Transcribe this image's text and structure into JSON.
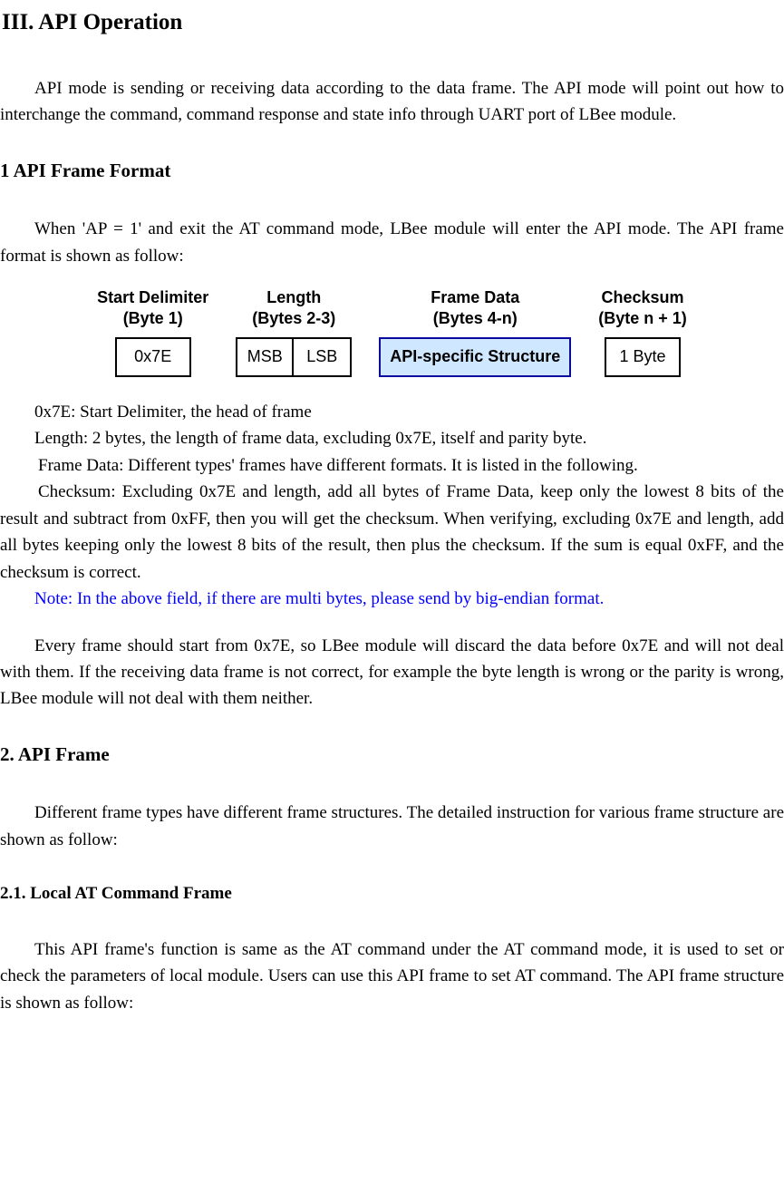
{
  "title": "III.  API Operation",
  "intro": "API mode is sending or receiving data according to the data frame. The API mode will point out how to interchange the command, command response and state info through UART port of LBee module.",
  "sec1": {
    "heading": "1 API Frame Format",
    "p1": "When 'AP = 1' and exit the AT command mode, LBee module will enter the API mode. The API frame format is shown as follow:",
    "fig": {
      "c1": {
        "title": "Start Delimiter\n(Byte 1)",
        "box": "0x7E"
      },
      "c2": {
        "title": "Length\n(Bytes 2-3)",
        "msb": "MSB",
        "lsb": "LSB"
      },
      "c3": {
        "title": "Frame Data\n(Bytes 4-n)",
        "box": "API-specific Structure"
      },
      "c4": {
        "title": "Checksum\n(Byte n + 1)",
        "box": "1 Byte"
      }
    },
    "bullets": {
      "b1": "0x7E: Start Delimiter, the head of frame",
      "b2": "Length: 2 bytes, the length of frame data, excluding 0x7E, itself and parity byte.",
      "b3": "Frame Data: Different types' frames have different formats. It is listed in the following.",
      "b4": "Checksum: Excluding 0x7E and length, add all bytes of Frame Data, keep only the lowest 8 bits of the result and subtract from 0xFF, then you will get the checksum. When verifying, excluding 0x7E and length, add all bytes keeping only the lowest 8 bits of the result, then plus the checksum. If the sum is equal 0xFF, and the checksum is correct."
    },
    "note": "Note: In the above field, if there are multi bytes, please send by big-endian format.",
    "p2": "Every frame should start from 0x7E, so LBee module will discard the data before 0x7E and will not deal with them. If the receiving data frame is not correct, for example the byte length is wrong or the parity is wrong, LBee module will not deal with them neither."
  },
  "sec2": {
    "heading": "2. API Frame",
    "p1": "Different frame types have different frame structures. The detailed instruction for various frame structure are shown as follow:",
    "sub": {
      "heading": "2.1. Local AT Command Frame",
      "p1": "This API frame's function is same as the AT command under the AT command mode, it is used to set or check the parameters of local module. Users can use this API frame to set AT command. The API frame structure is shown as follow:"
    }
  }
}
